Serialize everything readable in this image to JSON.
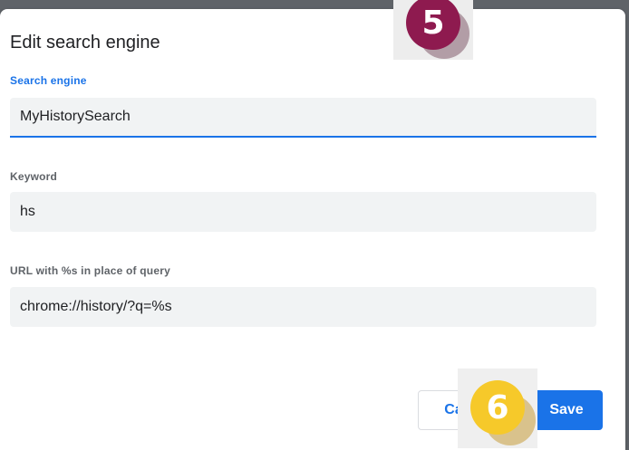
{
  "dialog": {
    "title": "Edit search engine",
    "fields": [
      {
        "label": "Search engine",
        "value": "MyHistorySearch"
      },
      {
        "label": "Keyword",
        "value": "hs"
      },
      {
        "label": "URL with %s in place of query",
        "value": "chrome://history/?q=%s"
      }
    ],
    "cancel_label": "Cancel",
    "save_label": "Save"
  },
  "annotations": {
    "step_5": "5",
    "step_6": "6"
  },
  "colors": {
    "accent": "#1a73e8",
    "badge_5": "#8e1a4f",
    "badge_6": "#f6c92a"
  }
}
